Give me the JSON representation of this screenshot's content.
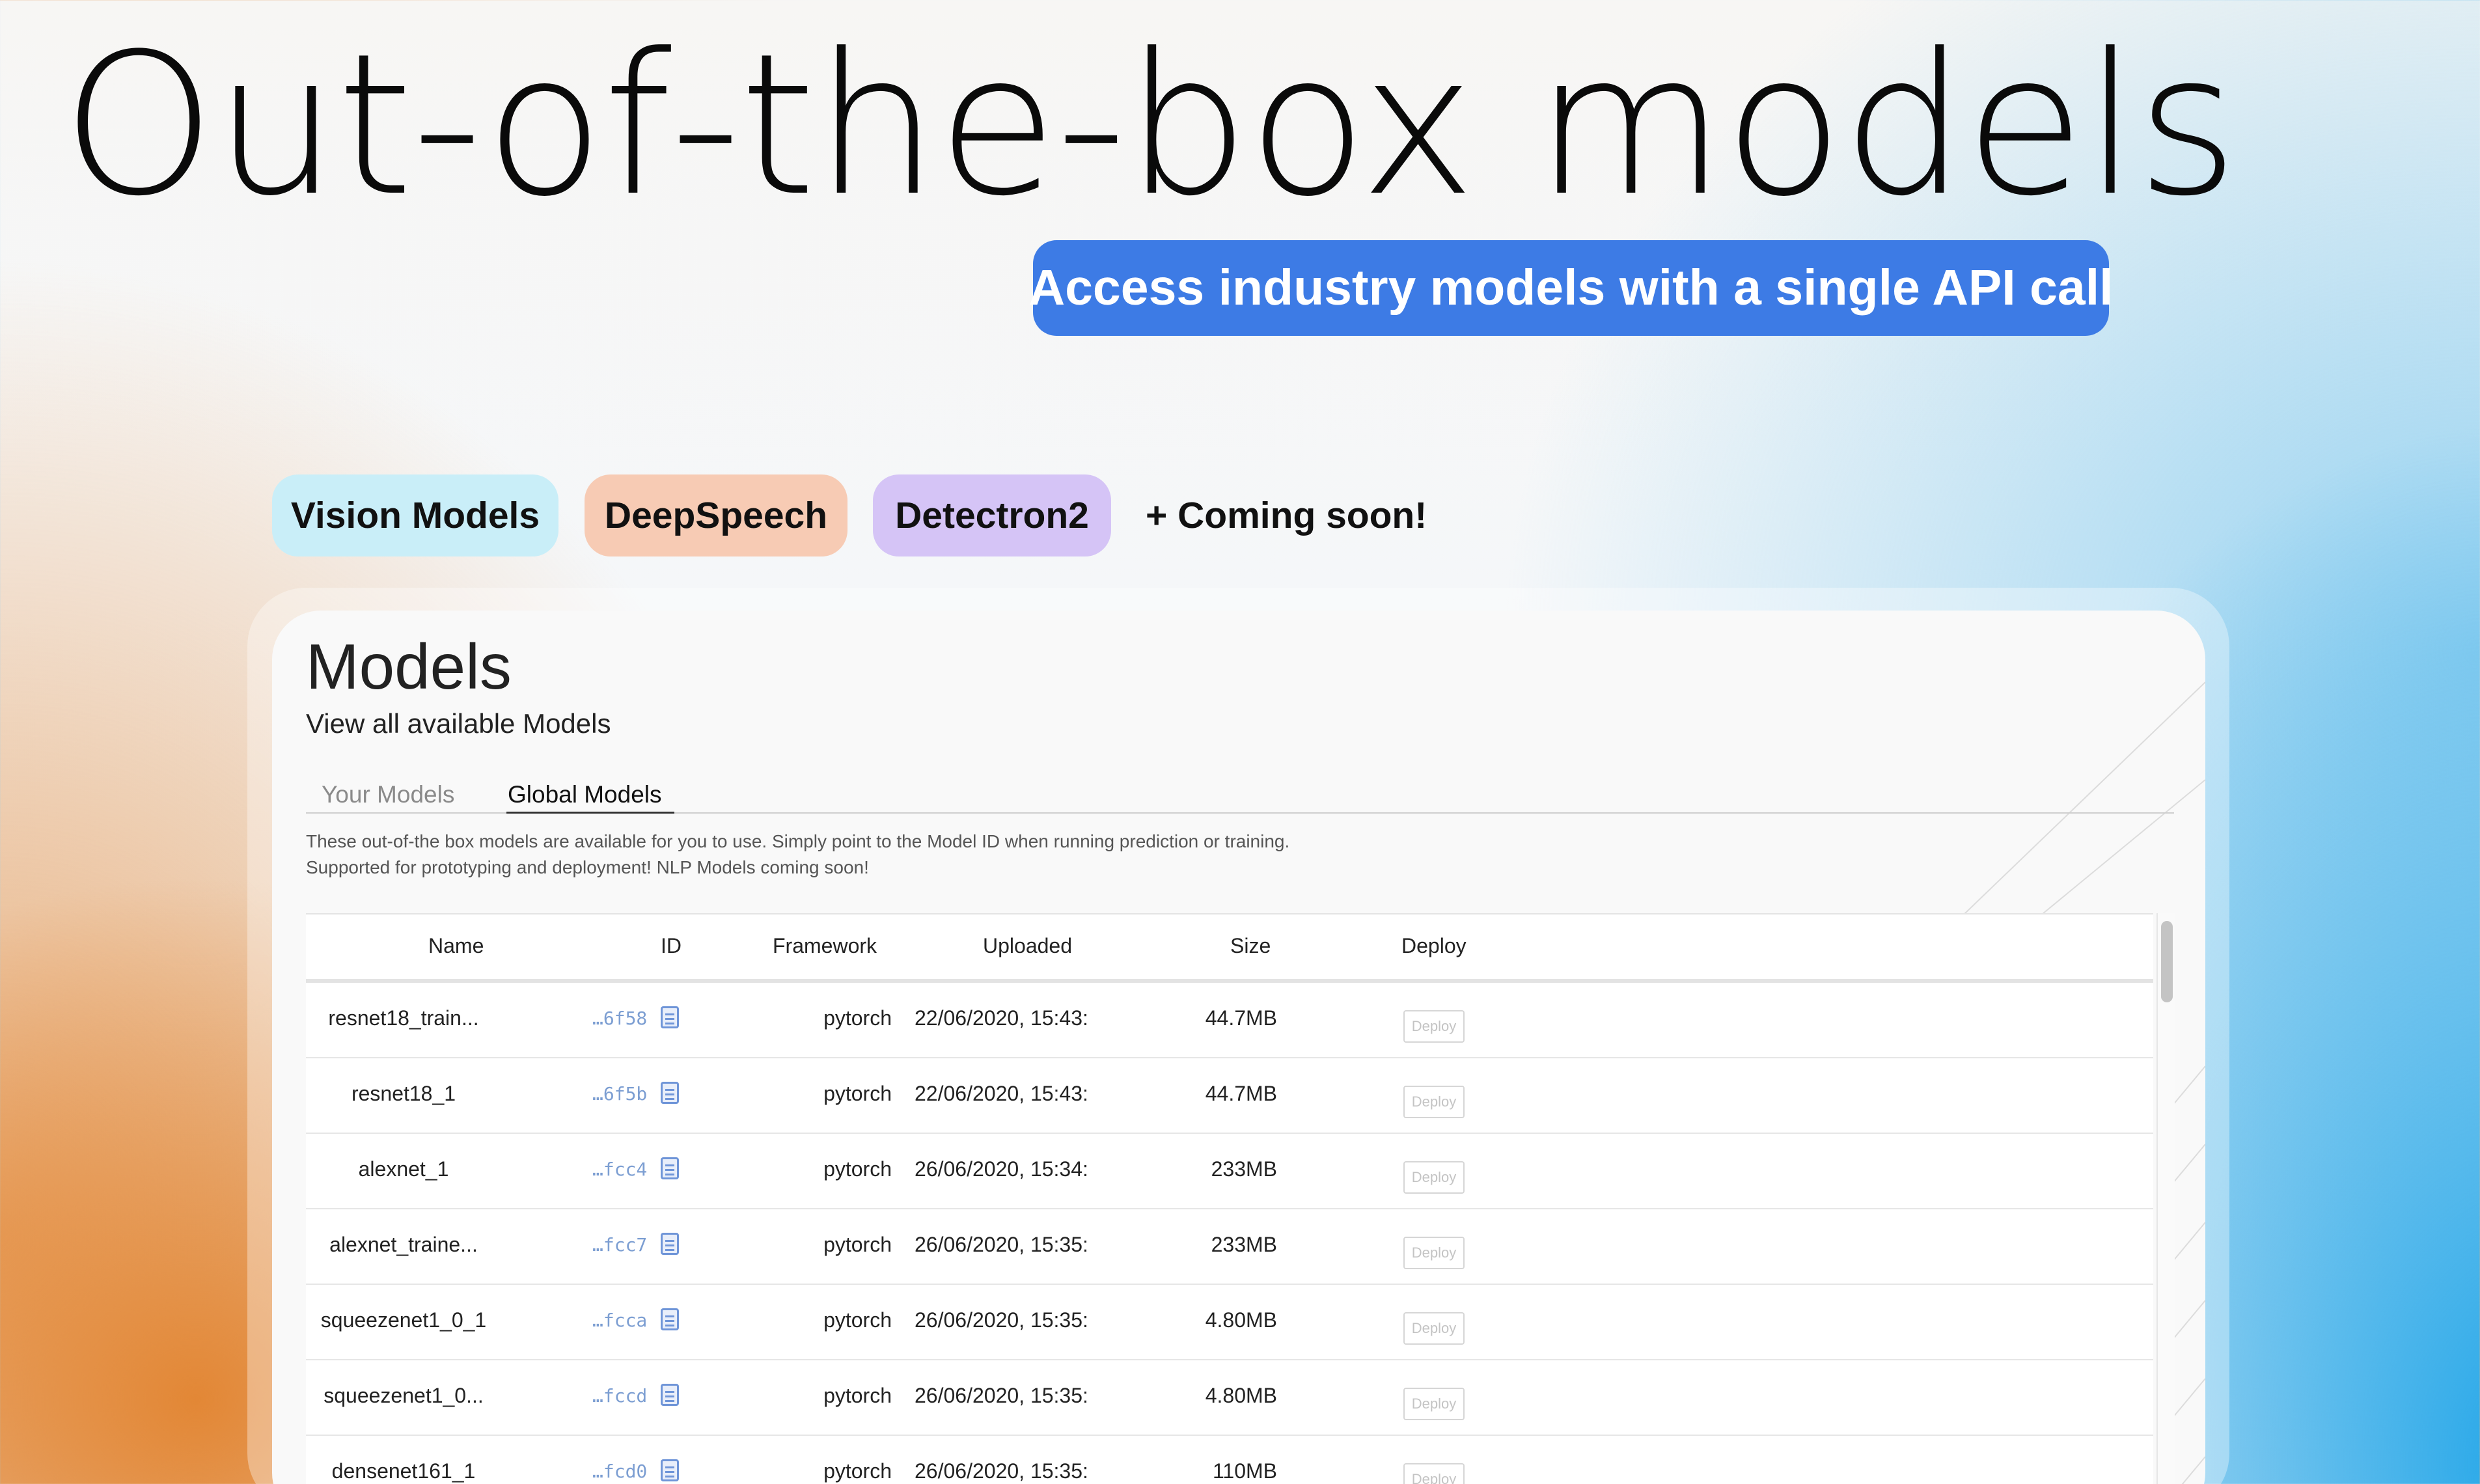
{
  "hero": {
    "title": "Out-of-the-box models",
    "subtitle": "Access industry models with a single API call"
  },
  "pills": [
    {
      "label": "Vision Models",
      "color": "#c9eef8"
    },
    {
      "label": "DeepSpeech",
      "color": "#f7cbb4"
    },
    {
      "label": "Detectron2",
      "color": "#d5c4f6"
    },
    {
      "label": "+ Coming soon!"
    }
  ],
  "models_panel": {
    "title": "Models",
    "subtitle": "View all available Models",
    "tabs": [
      {
        "label": "Your Models",
        "active": false
      },
      {
        "label": "Global Models",
        "active": true
      }
    ],
    "description_line1": "These out-of-the box models are available for you to use. Simply point to the Model ID when running prediction or training.",
    "description_line2": "Supported for prototyping and deployment! NLP Models coming soon!"
  },
  "table": {
    "headers": {
      "name": "Name",
      "id": "ID",
      "framework": "Framework",
      "uploaded": "Uploaded",
      "size": "Size",
      "deploy": "Deploy"
    },
    "rows": [
      {
        "name": "resnet18_train...",
        "id": "…6f58",
        "framework": "pytorch",
        "uploaded": "22/06/2020, 15:43:",
        "size": "44.7MB",
        "deploy": "Deploy"
      },
      {
        "name": "resnet18_1",
        "id": "…6f5b",
        "framework": "pytorch",
        "uploaded": "22/06/2020, 15:43:",
        "size": "44.7MB",
        "deploy": "Deploy"
      },
      {
        "name": "alexnet_1",
        "id": "…fcc4",
        "framework": "pytorch",
        "uploaded": "26/06/2020, 15:34:",
        "size": "233MB",
        "deploy": "Deploy"
      },
      {
        "name": "alexnet_traine...",
        "id": "…fcc7",
        "framework": "pytorch",
        "uploaded": "26/06/2020, 15:35:",
        "size": "233MB",
        "deploy": "Deploy"
      },
      {
        "name": "squeezenet1_0_1",
        "id": "…fcca",
        "framework": "pytorch",
        "uploaded": "26/06/2020, 15:35:",
        "size": "4.80MB",
        "deploy": "Deploy"
      },
      {
        "name": "squeezenet1_0...",
        "id": "…fccd",
        "framework": "pytorch",
        "uploaded": "26/06/2020, 15:35:",
        "size": "4.80MB",
        "deploy": "Deploy"
      },
      {
        "name": "densenet161_1",
        "id": "…fcd0",
        "framework": "pytorch",
        "uploaded": "26/06/2020, 15:35:",
        "size": "110MB",
        "deploy": "Deploy"
      }
    ]
  },
  "colors": {
    "accent": "#3d7be5",
    "id_text": "#7c9ed2"
  }
}
